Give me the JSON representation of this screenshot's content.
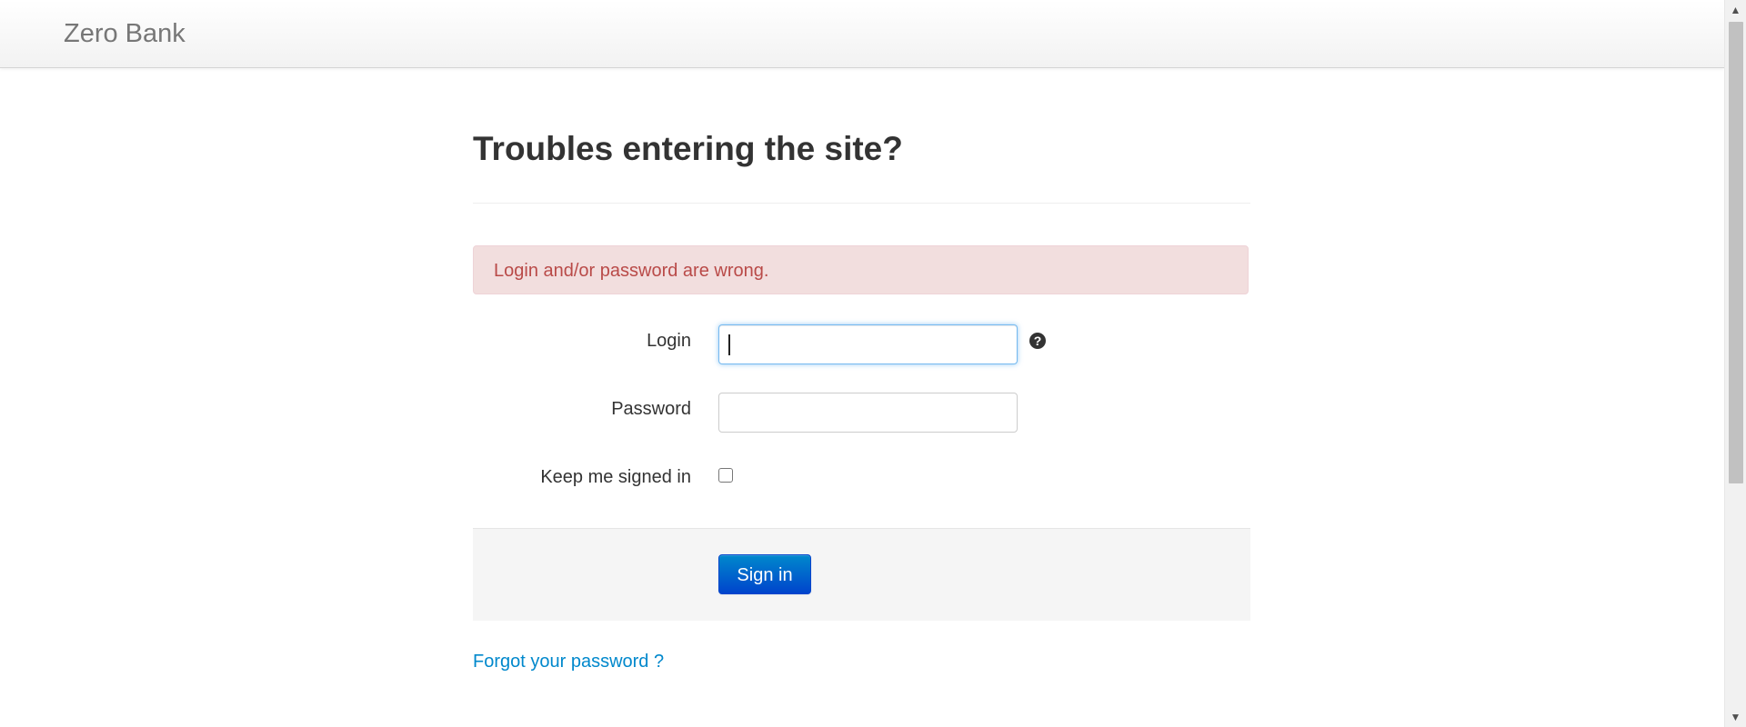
{
  "navbar": {
    "brand": "Zero Bank"
  },
  "main": {
    "title": "Troubles entering the site?",
    "alert": "Login and/or password are wrong."
  },
  "form": {
    "login_label": "Login",
    "login_value": "",
    "help_icon": "question-circle-icon",
    "password_label": "Password",
    "password_value": "",
    "keep_signed_in_label": "Keep me signed in",
    "keep_signed_in_checked": false,
    "sign_in_label": "Sign in",
    "forgot_password_label": "Forgot your password ?"
  },
  "colors": {
    "alert_background": "#f2dede",
    "alert_text": "#b94a48",
    "button_top": "#0088cc",
    "button_bottom": "#0044cc",
    "link": "#0088cc"
  },
  "icons": {
    "scroll_up": "triangle-up-icon",
    "scroll_down": "triangle-down-icon"
  }
}
